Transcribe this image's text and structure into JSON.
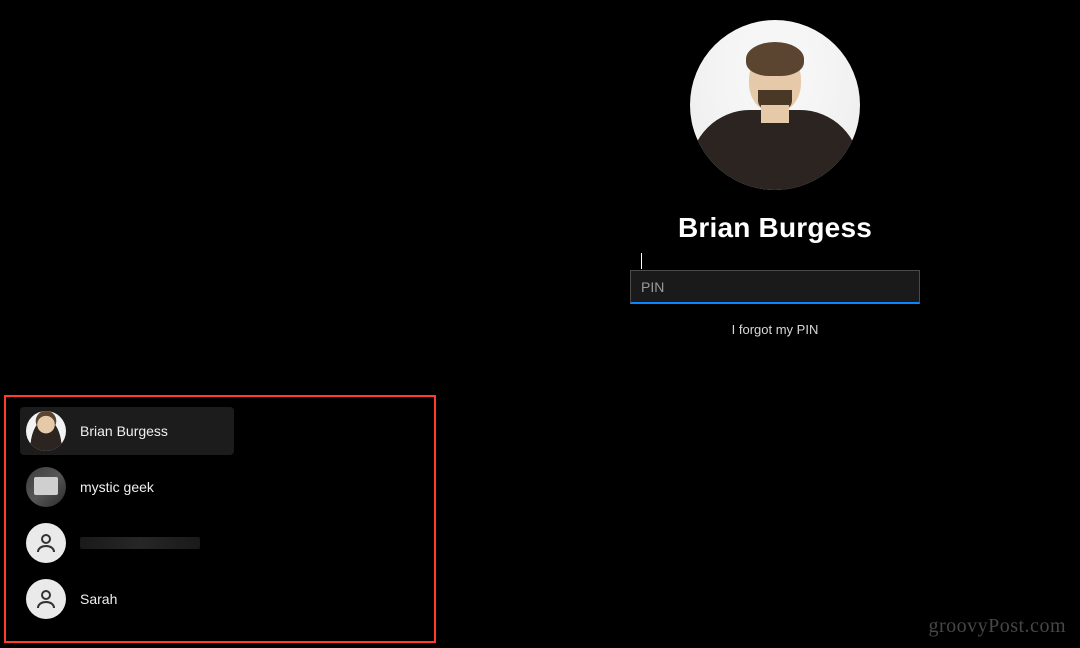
{
  "selected_user": {
    "name": "Brian Burgess",
    "avatar_type": "photo-brian"
  },
  "pin_input": {
    "placeholder": "PIN",
    "value": "",
    "accent_color": "#0a84ff"
  },
  "forgot_link": "I forgot my PIN",
  "user_list": [
    {
      "name": "Brian Burgess",
      "avatar": "brian",
      "selected": true
    },
    {
      "name": "mystic geek",
      "avatar": "mystic",
      "selected": false
    },
    {
      "name": "",
      "avatar": "generic",
      "selected": false,
      "redacted": true
    },
    {
      "name": "Sarah",
      "avatar": "generic",
      "selected": false
    }
  ],
  "annotation": {
    "highlight_box_color": "#ff3c2a"
  },
  "watermark": "groovyPost.com"
}
